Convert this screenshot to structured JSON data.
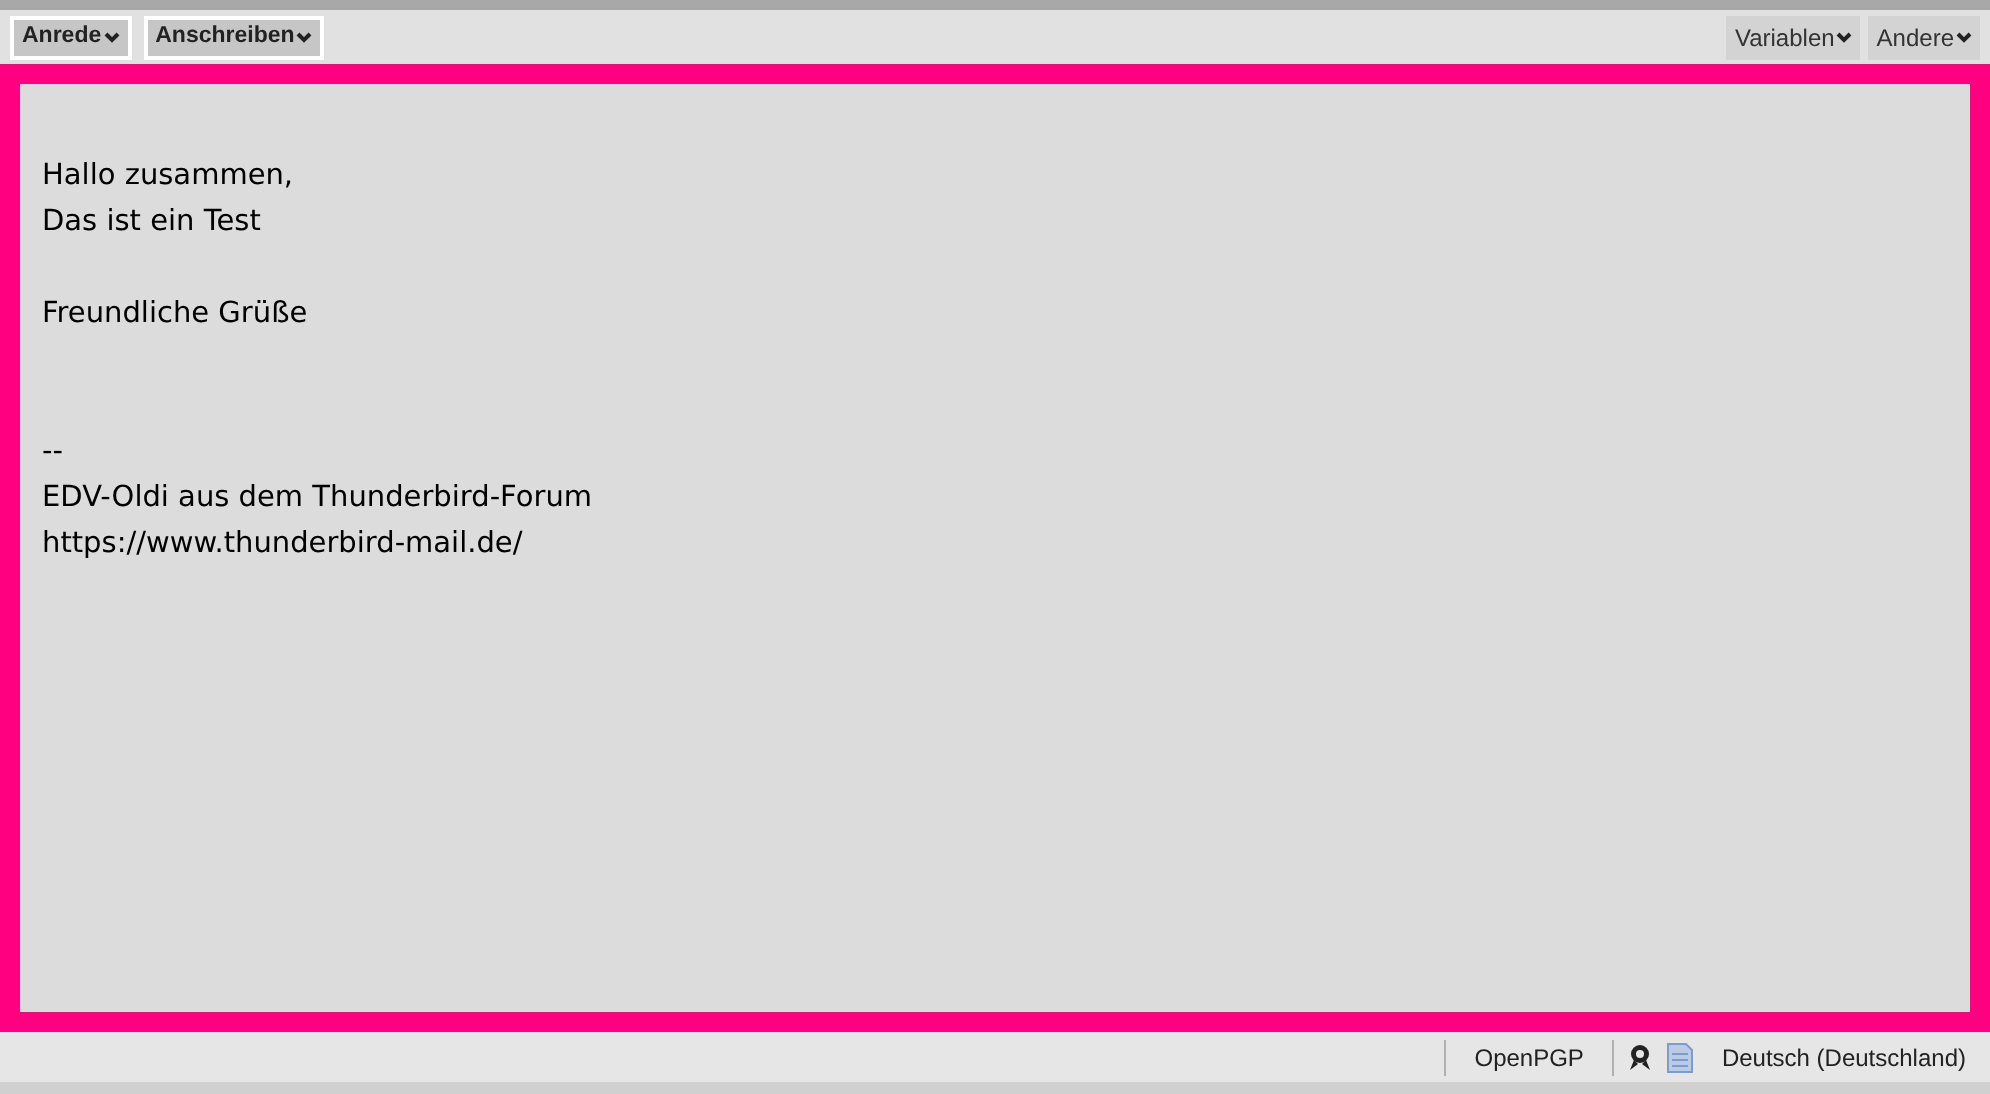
{
  "toolbar": {
    "left": [
      {
        "label": "Anrede",
        "kind": "framed"
      },
      {
        "label": "Anschreiben",
        "kind": "framed"
      }
    ],
    "right": [
      {
        "label": "Variablen",
        "kind": "plain"
      },
      {
        "label": "Andere",
        "kind": "plain"
      }
    ]
  },
  "editor": {
    "paragraphs": [
      [
        "Hallo zusammen,",
        "Das ist ein Test"
      ],
      [
        "Freundliche Grüße"
      ],
      [
        "--",
        "EDV-Oldi aus dem Thunderbird-Forum",
        "https://www.thunderbird-mail.de/"
      ]
    ]
  },
  "status_bar": {
    "encryption": "OpenPGP",
    "language": "Deutsch (Deutschland)"
  }
}
